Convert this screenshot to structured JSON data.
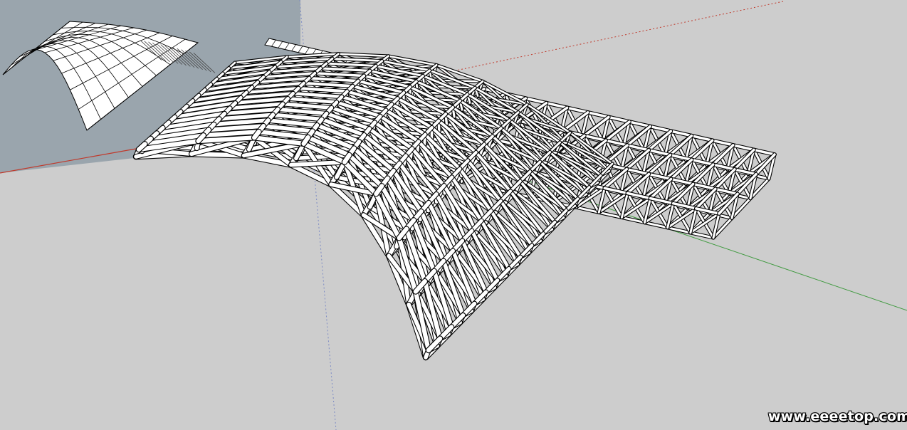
{
  "watermark": {
    "text": "www.eeeetop.com"
  },
  "scene": {
    "ground_color": "#cdcdcd",
    "sky_color": "#9aa5ad",
    "structure_color": "#ffffff",
    "edge_color": "#000000",
    "axis_colors": {
      "red": "#c0392b",
      "green": "#3f9a3f",
      "blue": "#7d8bc4"
    },
    "objects": [
      {
        "name": "barrel-vault-surface",
        "grid_cols": 10,
        "grid_rows": 8
      },
      {
        "name": "arched-space-truss",
        "bays_along": 16,
        "bays_across": 8
      },
      {
        "name": "flat-space-truss",
        "bays_along": 14,
        "bays_across": 3
      }
    ]
  }
}
